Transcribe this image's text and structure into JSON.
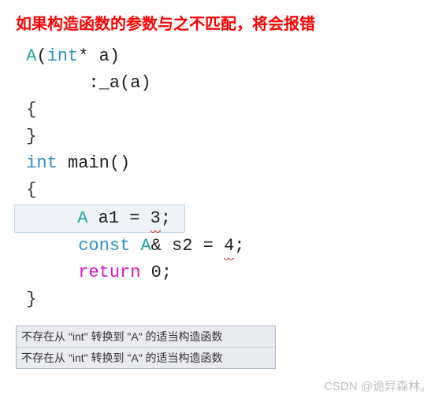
{
  "title": "如果构造函数的参数与之不匹配，将会报错",
  "code": {
    "line1_cls": "A",
    "line1_paren_open": "(",
    "line1_type": "int",
    "line1_ptr": "* ",
    "line1_var": "a",
    "line1_paren_close": ")",
    "line2_init": ":_a",
    "line2_paren_open": "(",
    "line2_var": "a",
    "line2_paren_close": ")",
    "line3_brace": "{",
    "line4_brace": "}",
    "line5_type": "int",
    "line5_space": " ",
    "line5_main": "main",
    "line5_parens": "()",
    "line6_brace": "{",
    "line7_cls": "A",
    "line7_space": " ",
    "line7_var": "a1 = ",
    "line7_num": "3",
    "line7_semi": ";",
    "line8_kw": "const",
    "line8_space": " ",
    "line8_cls": "A",
    "line8_ref": "&",
    "line8_var": " s2 = ",
    "line8_num": "4",
    "line8_semi": ";",
    "line9_kw": "return",
    "line9_space": " ",
    "line9_num": "0",
    "line9_semi": ";",
    "line10_brace": "}"
  },
  "errors": {
    "e1": "不存在从 \"int\" 转换到 \"A\" 的适当构造函数",
    "e2": "不存在从 \"int\" 转换到 \"A\" 的适当构造函数"
  },
  "watermark": "CSDN @诡异森林。"
}
